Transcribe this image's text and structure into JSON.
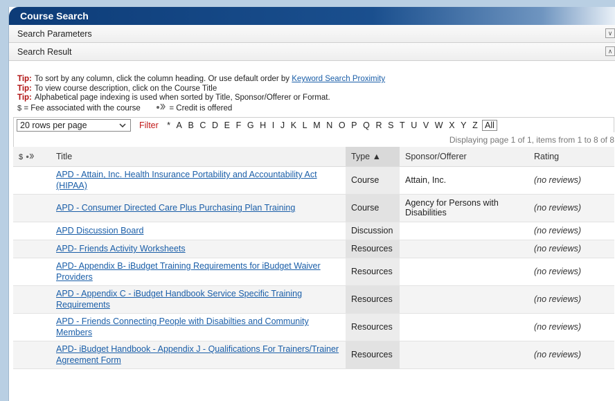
{
  "window": {
    "title": "Course Search"
  },
  "panels": [
    {
      "label": "Search Parameters",
      "chevron": "chevron-down-icon",
      "glyph": "∨"
    },
    {
      "label": "Search Result",
      "chevron": "chevron-up-icon",
      "glyph": "∧"
    }
  ],
  "tips": [
    {
      "label": "Tip:",
      "text": "To sort by any column, click the column heading. Or use default order by ",
      "link": "Keyword Search Proximity"
    },
    {
      "label": "Tip:",
      "text": "To view course description, click on the Course Title"
    },
    {
      "label": "Tip:",
      "text": "Alphabetical page indexing is used when sorted by Title, Sponsor/Offerer or Format."
    }
  ],
  "legend": {
    "fee_symbol": "$",
    "fee_text": "= Fee associated with the course",
    "credit_text": "= Credit is offered"
  },
  "pager": {
    "rows_per_page": "20 rows per page",
    "filter_label": "Filter",
    "letters": [
      "*",
      "A",
      "B",
      "C",
      "D",
      "E",
      "F",
      "G",
      "H",
      "I",
      "J",
      "K",
      "L",
      "M",
      "N",
      "O",
      "P",
      "Q",
      "R",
      "S",
      "T",
      "U",
      "V",
      "W",
      "X",
      "Y",
      "Z"
    ],
    "all_label": "All",
    "displaying": "Displaying page 1 of 1, items from 1 to 8 of 8"
  },
  "table": {
    "headers": {
      "fee": "$",
      "title": "Title",
      "type": "Type ▲",
      "sponsor": "Sponsor/Offerer",
      "rating": "Rating"
    },
    "rows": [
      {
        "title": "APD - Attain, Inc. Health Insurance Portability and Accountability Act (HIPAA)",
        "type": "Course",
        "sponsor": "Attain, Inc.",
        "rating": "(no reviews)"
      },
      {
        "title": "APD - Consumer Directed Care Plus Purchasing Plan Training",
        "type": "Course",
        "sponsor": "Agency for Persons with Disabilities",
        "rating": "(no reviews)"
      },
      {
        "title": "APD Discussion Board",
        "type": "Discussion",
        "sponsor": "",
        "rating": "(no reviews)"
      },
      {
        "title": "APD- Friends Activity Worksheets",
        "type": "Resources",
        "sponsor": "",
        "rating": "(no reviews)"
      },
      {
        "title": "APD- Appendix B- iBudget Training Requirements for iBudget Waiver Providers",
        "type": "Resources",
        "sponsor": "",
        "rating": "(no reviews)"
      },
      {
        "title": "APD - Appendix C - iBudget Handbook Service Specific Training Requirements",
        "type": "Resources",
        "sponsor": "",
        "rating": "(no reviews)"
      },
      {
        "title": "APD - Friends Connecting People with Disabilties and Community Members",
        "type": "Resources",
        "sponsor": "",
        "rating": "(no reviews)"
      },
      {
        "title": "APD- iBudget Handbook - Appendix J - Qualifications For Trainers/Trainer Agreement Form",
        "type": "Resources",
        "sponsor": "",
        "rating": "(no reviews)"
      }
    ]
  },
  "colors": {
    "title_bar": "#0d3c78",
    "link": "#1a5ea8",
    "tip_label": "#b01010",
    "filter": "#c01818"
  }
}
